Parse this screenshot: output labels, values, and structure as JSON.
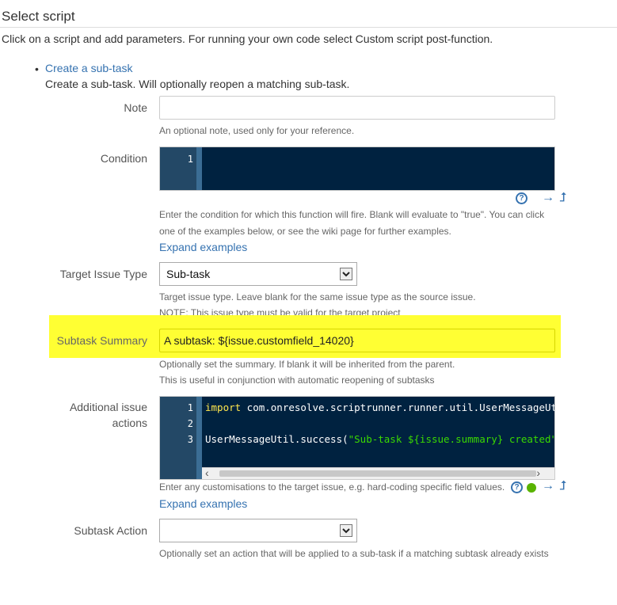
{
  "page": {
    "title": "Select script",
    "intro": "Click on a script and add parameters. For running your own code select Custom script post-function."
  },
  "script": {
    "bullet": "•",
    "name": "Create a sub-task",
    "description": "Create a sub-task. Will optionally reopen a matching sub-task."
  },
  "fields": {
    "note": {
      "label": "Note",
      "value": "",
      "help": "An optional note, used only for your reference."
    },
    "condition": {
      "label": "Condition",
      "line_numbers": [
        "1"
      ],
      "help_line1": "Enter the condition for which this function will fire. Blank will evaluate to \"true\". You can click",
      "help_line2": "one of the examples below, or see the wiki page for further examples.",
      "expand": "Expand examples"
    },
    "target_issue_type": {
      "label": "Target Issue Type",
      "selected": "Sub-task",
      "help_line1": "Target issue type. Leave blank for the same issue type as the source issue.",
      "help_line2": "NOTE: This issue type must be valid for the target project"
    },
    "subtask_summary": {
      "label": "Subtask Summary",
      "value": "A subtask: ${issue.customfield_14020}",
      "help_line1": "Optionally set the summary. If blank it will be inherited from the parent.",
      "help_line2": "This is useful in conjunction with automatic reopening of subtasks"
    },
    "additional_actions": {
      "label_line1": "Additional issue",
      "label_line2": "actions",
      "line_numbers": [
        "1",
        "2",
        "3"
      ],
      "code_line1_kw": "import",
      "code_line1_rest": " com.onresolve.scriptrunner.runner.util.UserMessageUtil",
      "code_line3_call": "UserMessageUtil.success(",
      "code_line3_str": "\"Sub-task ${issue.summary} created\")",
      "help": "Enter any customisations to the target issue, e.g. hard-coding specific field values.",
      "expand": "Expand examples"
    },
    "subtask_action": {
      "label": "Subtask Action",
      "selected": "",
      "help": "Optionally set an action that will be applied to a sub-task if a matching subtask already exists"
    }
  },
  "icons": {
    "help": "question-circle",
    "arrow_right": "→",
    "arrow_up": "⮥",
    "status_dot_color": "#59b300",
    "link_color": "#3572b0",
    "highlight_color": "#ffff33"
  }
}
